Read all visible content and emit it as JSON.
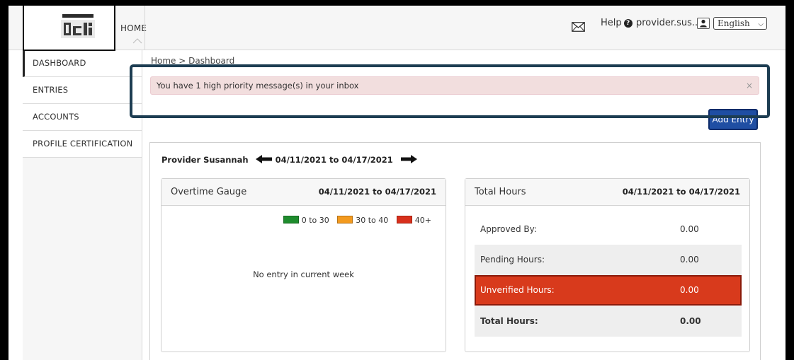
{
  "header": {
    "home_label": "HOME",
    "help_label": "Help",
    "help_icon": "question-circle-icon",
    "user_label": "provider.sus...",
    "user_icon": "user-icon",
    "mail_icon": "envelope-icon",
    "language": "English"
  },
  "sidebar": {
    "items": [
      {
        "label": "DASHBOARD"
      },
      {
        "label": "ENTRIES"
      },
      {
        "label": "ACCOUNTS"
      },
      {
        "label": "PROFILE CERTIFICATION"
      }
    ]
  },
  "breadcrumb": "Home > Dashboard",
  "alert": {
    "text": "You have 1 high priority message(s) in your inbox",
    "close": "×"
  },
  "add_entry_label": "Add Entry",
  "week": {
    "provider": "Provider Susannah",
    "range": "04/11/2021 to 04/17/2021"
  },
  "overtime": {
    "title": "Overtime Gauge",
    "range": "04/11/2021 to 04/17/2021",
    "legend": [
      {
        "label": "0 to 30",
        "color": "#1e8c2d"
      },
      {
        "label": "30 to 40",
        "color": "#f39a1e"
      },
      {
        "label": "40+",
        "color": "#d8301c"
      }
    ],
    "empty_text": "No entry in current week"
  },
  "totals": {
    "title": "Total Hours",
    "range": "04/11/2021 to 04/17/2021",
    "rows": [
      {
        "label": "Approved By:",
        "value": "0.00"
      },
      {
        "label": "Pending Hours:",
        "value": "0.00"
      },
      {
        "label": "Unverified Hours:",
        "value": "0.00"
      },
      {
        "label": "Total Hours:",
        "value": "0.00"
      }
    ]
  },
  "colors": {
    "alert_bg": "#f2dede",
    "highlight_border": "#1d3d52",
    "button_bg": "#1f4ea3",
    "unverified_bg": "#d83a1c"
  }
}
